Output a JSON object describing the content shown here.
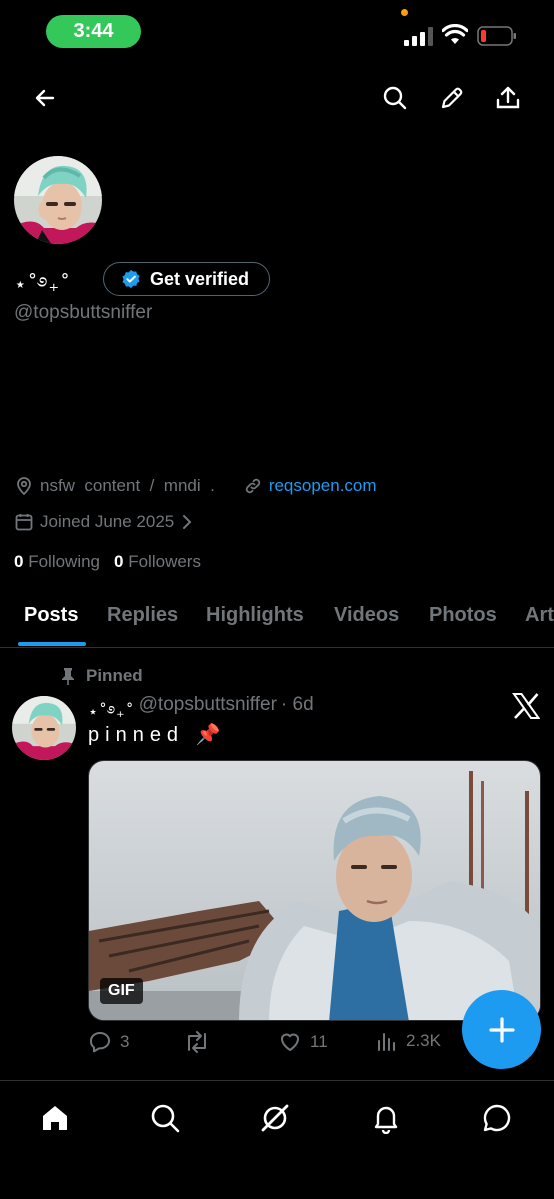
{
  "status_bar": {
    "time": "3:44"
  },
  "profile": {
    "display_name": "⋆˚࿔₊˚",
    "verify_label": "Get verified",
    "handle": "@topsbuttsniffer",
    "bio_location": "nsfw  content  /  mndi  .",
    "website": "reqsopen.com",
    "joined": "Joined June 2025",
    "following_count": "0",
    "following_label": "Following",
    "followers_count": "0",
    "followers_label": "Followers"
  },
  "tabs": [
    "Posts",
    "Replies",
    "Highlights",
    "Videos",
    "Photos",
    "Art"
  ],
  "post": {
    "pinned_label": "Pinned",
    "author_name": "⋆˚࿔₊˚",
    "author_handle": "@topsbuttsniffer",
    "time": "· 6d",
    "text": "pinned",
    "emoji": "📌",
    "media_badge": "GIF",
    "replies": "3",
    "likes": "11",
    "views": "2.3K"
  },
  "icons": {
    "back": "back-arrow-icon",
    "search": "search-icon",
    "edit": "pencil-icon",
    "share": "share-icon",
    "verified": "verified-badge-icon",
    "location": "location-pin-icon",
    "link": "link-icon",
    "calendar": "calendar-icon",
    "pin": "pin-icon",
    "x_logo": "x-logo-icon",
    "reply": "reply-icon",
    "repost": "repost-icon",
    "like": "heart-icon",
    "views": "views-icon",
    "compose": "plus-icon",
    "home": "home-icon",
    "explore": "search-icon",
    "grok": "grok-icon",
    "notifications": "bell-icon",
    "messages": "message-icon"
  },
  "colors": {
    "accent": "#1d9bf0",
    "background": "#000000",
    "secondary_text": "#71767b",
    "status_green": "#34c759"
  }
}
